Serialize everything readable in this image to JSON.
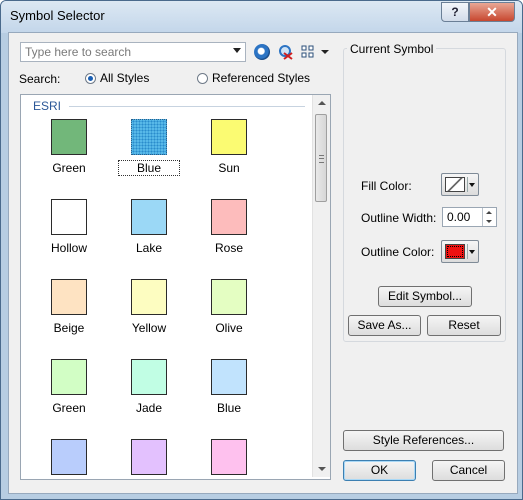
{
  "window": {
    "title": "Symbol Selector",
    "help_label": "?",
    "close_label": "✕"
  },
  "search": {
    "placeholder": "Type here to search",
    "label": "Search:",
    "options": [
      "All Styles",
      "Referenced Styles"
    ],
    "selected": "All Styles"
  },
  "gallery": {
    "group": "ESRI",
    "selected_index": 1,
    "symbols": [
      {
        "name": "Green",
        "color": "#72b77a"
      },
      {
        "name": "Blue",
        "color": "#57b8e8"
      },
      {
        "name": "Sun",
        "color": "#fbfb72"
      },
      {
        "name": "Hollow",
        "color": "#ffffff"
      },
      {
        "name": "Lake",
        "color": "#9bd8f6"
      },
      {
        "name": "Rose",
        "color": "#fdbcbc"
      },
      {
        "name": "Beige",
        "color": "#fee3c2"
      },
      {
        "name": "Yellow",
        "color": "#fdfdc1"
      },
      {
        "name": "Olive",
        "color": "#e4fec2"
      },
      {
        "name": "Green",
        "color": "#d2fec5"
      },
      {
        "name": "Jade",
        "color": "#c1fee4"
      },
      {
        "name": "Blue",
        "color": "#c1e3fd"
      },
      {
        "name": "",
        "color": "#b9cdfc"
      },
      {
        "name": "",
        "color": "#e3c1fe"
      },
      {
        "name": "",
        "color": "#fec1ee"
      }
    ]
  },
  "current_symbol": {
    "title": "Current Symbol",
    "fill_color_label": "Fill Color:",
    "outline_width_label": "Outline Width:",
    "outline_width_value": "0.00",
    "outline_color_label": "Outline Color:",
    "outline_color": "#ee1111"
  },
  "buttons": {
    "edit_symbol": "Edit Symbol...",
    "save_as": "Save As...",
    "reset": "Reset",
    "style_references": "Style References...",
    "ok": "OK",
    "cancel": "Cancel"
  }
}
